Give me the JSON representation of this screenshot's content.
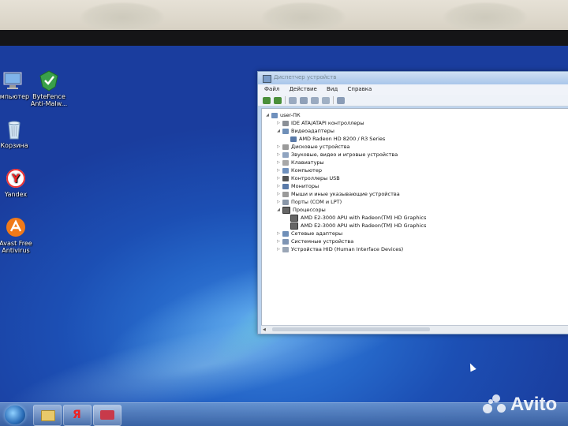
{
  "desktop": {
    "icons": [
      {
        "label": "омпьютер",
        "icon": "computer-icon"
      },
      {
        "label": "ByteFence Anti-Malw...",
        "icon": "bytefence-icon"
      },
      {
        "label": "Корзина",
        "icon": "recycle-bin-icon"
      },
      {
        "label": "Yandex",
        "icon": "yandex-browser-icon"
      },
      {
        "label": "Avast Free Antivirus",
        "icon": "avast-icon"
      }
    ]
  },
  "window": {
    "title": "Диспетчер устройств",
    "menu": [
      "Файл",
      "Действие",
      "Вид",
      "Справка"
    ],
    "tree": {
      "root": "user-ПК",
      "items": [
        {
          "label": "IDE ATA/ATAPI контроллеры",
          "expander": "▷",
          "icon": "ide-controller-icon"
        },
        {
          "label": "Видеоадаптеры",
          "expander": "◢",
          "icon": "display-adapter-icon"
        },
        {
          "label": "AMD Radeon HD 8200 / R3 Series",
          "expander": "",
          "icon": "monitor-icon"
        },
        {
          "label": "Дисковые устройства",
          "expander": "▷",
          "icon": "disk-drive-icon"
        },
        {
          "label": "Звуковые, видео и игровые устройства",
          "expander": "▷",
          "icon": "sound-icon"
        },
        {
          "label": "Клавиатуры",
          "expander": "▷",
          "icon": "keyboard-icon"
        },
        {
          "label": "Компьютер",
          "expander": "▷",
          "icon": "computer-icon"
        },
        {
          "label": "Контроллеры USB",
          "expander": "▷",
          "icon": "usb-icon"
        },
        {
          "label": "Мониторы",
          "expander": "▷",
          "icon": "monitor-icon"
        },
        {
          "label": "Мыши и иные указывающие устройства",
          "expander": "▷",
          "icon": "mouse-icon"
        },
        {
          "label": "Порты (COM и LPT)",
          "expander": "▷",
          "icon": "port-icon"
        },
        {
          "label": "Процессоры",
          "expander": "◢",
          "icon": "processor-icon"
        },
        {
          "label": "AMD E2-3000 APU with Radeon(TM) HD Graphics",
          "expander": "",
          "icon": "processor-icon"
        },
        {
          "label": "AMD E2-3000 APU with Radeon(TM) HD Graphics",
          "expander": "",
          "icon": "processor-icon"
        },
        {
          "label": "Сетевые адаптеры",
          "expander": "▷",
          "icon": "network-adapter-icon"
        },
        {
          "label": "Системные устройства",
          "expander": "▷",
          "icon": "system-device-icon"
        },
        {
          "label": "Устройства HID (Human Interface Devices)",
          "expander": "▷",
          "icon": "hid-icon"
        }
      ]
    }
  },
  "taskbar": {
    "buttons": [
      "start-orb-icon",
      "explorer-icon",
      "yandex-icon",
      "device-manager-icon"
    ]
  },
  "watermark": {
    "text": "Avito"
  }
}
